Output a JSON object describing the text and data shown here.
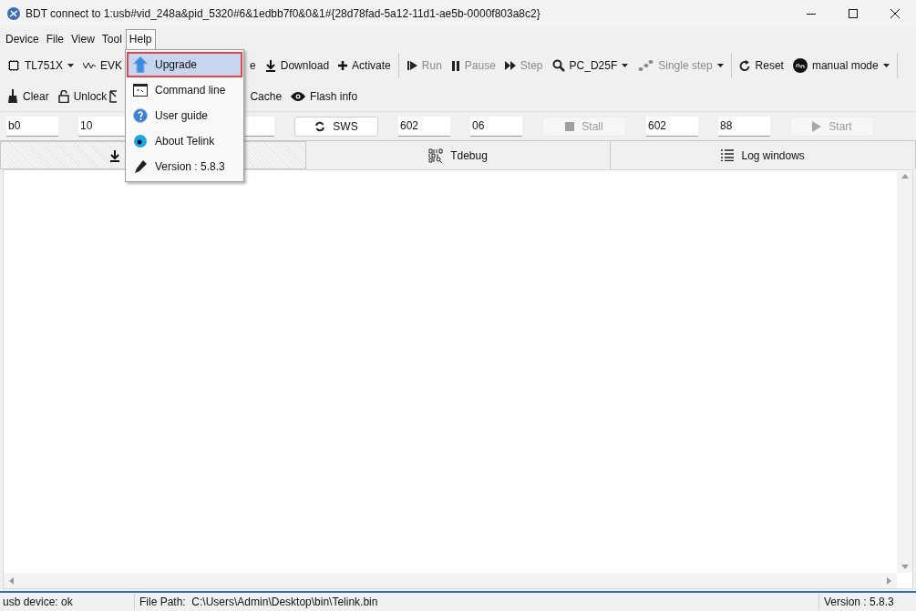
{
  "window": {
    "title": "BDT connect to 1:usb#vid_248a&pid_5320#6&1edbb7f0&0&1#{28d78fad-5a12-11d1-ae5b-0000f803a8c2}"
  },
  "menubar": [
    {
      "label": "Device",
      "selected": false
    },
    {
      "label": "File",
      "selected": false
    },
    {
      "label": "View",
      "selected": false
    },
    {
      "label": "Tool",
      "selected": false
    },
    {
      "label": "Help",
      "selected": true
    }
  ],
  "help_menu": [
    {
      "label": "Upgrade",
      "selected": true
    },
    {
      "label": "Command line",
      "selected": false
    },
    {
      "label": "User guide",
      "selected": false
    },
    {
      "label": "About Telink",
      "selected": false
    },
    {
      "label": "Version : 5.8.3",
      "selected": false
    }
  ],
  "toolbar1": [
    {
      "kind": "dropdown",
      "label": "TL751X",
      "disabled": false
    },
    {
      "kind": "dropdown",
      "label": "EVK",
      "disabled": false
    },
    {
      "kind": "gap"
    },
    {
      "kind": "button",
      "label": "e",
      "disabled": false
    },
    {
      "kind": "button",
      "label": "Download",
      "disabled": false
    },
    {
      "kind": "button",
      "label": "Activate",
      "disabled": false
    },
    {
      "kind": "separator"
    },
    {
      "kind": "button",
      "label": "Run",
      "disabled": true
    },
    {
      "kind": "button",
      "label": "Pause",
      "disabled": true
    },
    {
      "kind": "button",
      "label": "Step",
      "disabled": true
    },
    {
      "kind": "dropdown",
      "label": "PC_D25F",
      "disabled": false
    },
    {
      "kind": "dropdown",
      "label": "Single step",
      "disabled": true
    },
    {
      "kind": "separator"
    },
    {
      "kind": "button",
      "label": "Reset",
      "disabled": false
    },
    {
      "kind": "dropdown",
      "label": "manual mode",
      "disabled": false
    },
    {
      "kind": "separator"
    }
  ],
  "toolbar2": [
    {
      "kind": "button",
      "label": "Clear"
    },
    {
      "kind": "button",
      "label": "Unlock"
    },
    {
      "kind": "partial"
    },
    {
      "kind": "gap"
    },
    {
      "kind": "button",
      "label": "Cache"
    },
    {
      "kind": "button",
      "label": "Flash info"
    }
  ],
  "fields": [
    {
      "kind": "field",
      "value": "b0"
    },
    {
      "kind": "field",
      "value": "10"
    },
    {
      "kind": "hidden"
    },
    {
      "kind": "field_end"
    },
    {
      "kind": "button",
      "label": "SWS",
      "disabled": false
    },
    {
      "kind": "field",
      "value": "602"
    },
    {
      "kind": "field",
      "value": "06"
    },
    {
      "kind": "button",
      "label": "Stall",
      "disabled": true
    },
    {
      "kind": "field",
      "value": "602"
    },
    {
      "kind": "field",
      "value": "88"
    },
    {
      "kind": "button",
      "label": "Start",
      "disabled": true
    }
  ],
  "tabs": [
    {
      "selected": true
    },
    {
      "label": "Tdebug",
      "selected": false
    },
    {
      "label": "Log windows",
      "selected": false
    }
  ],
  "status_bar": {
    "device": "usb device: ok",
    "file_path": "File Path:  C:\\Users\\Admin\\Desktop\\bin\\Telink.bin",
    "version": "Version : 5.8.3"
  }
}
